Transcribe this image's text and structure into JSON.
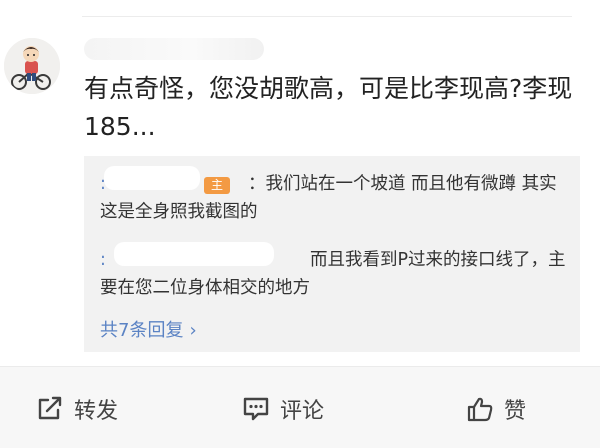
{
  "comment": {
    "text": "有点奇怪，您没胡歌高，可是比李现高?李现185..."
  },
  "replies": [
    {
      "badge": "主",
      "text": "：我们站在一个坡道 而且他有微蹲 其实这是全身照我截图的"
    },
    {
      "text": "而且我看到P过来的接口线了，主要在您二位身体相交的地方"
    }
  ],
  "more_replies": {
    "label": "共7条回复",
    "chevron": "›"
  },
  "actions": {
    "forward": "转发",
    "comment": "评论",
    "like": "赞"
  },
  "icons": {
    "forward": "share-box-icon",
    "comment": "comment-bubble-icon",
    "like": "thumbs-up-icon"
  },
  "colors": {
    "link": "#5b83c4",
    "badge": "#f39a43",
    "reply_background": "#f2f2f2",
    "action_bar": "#f7f7f7"
  }
}
